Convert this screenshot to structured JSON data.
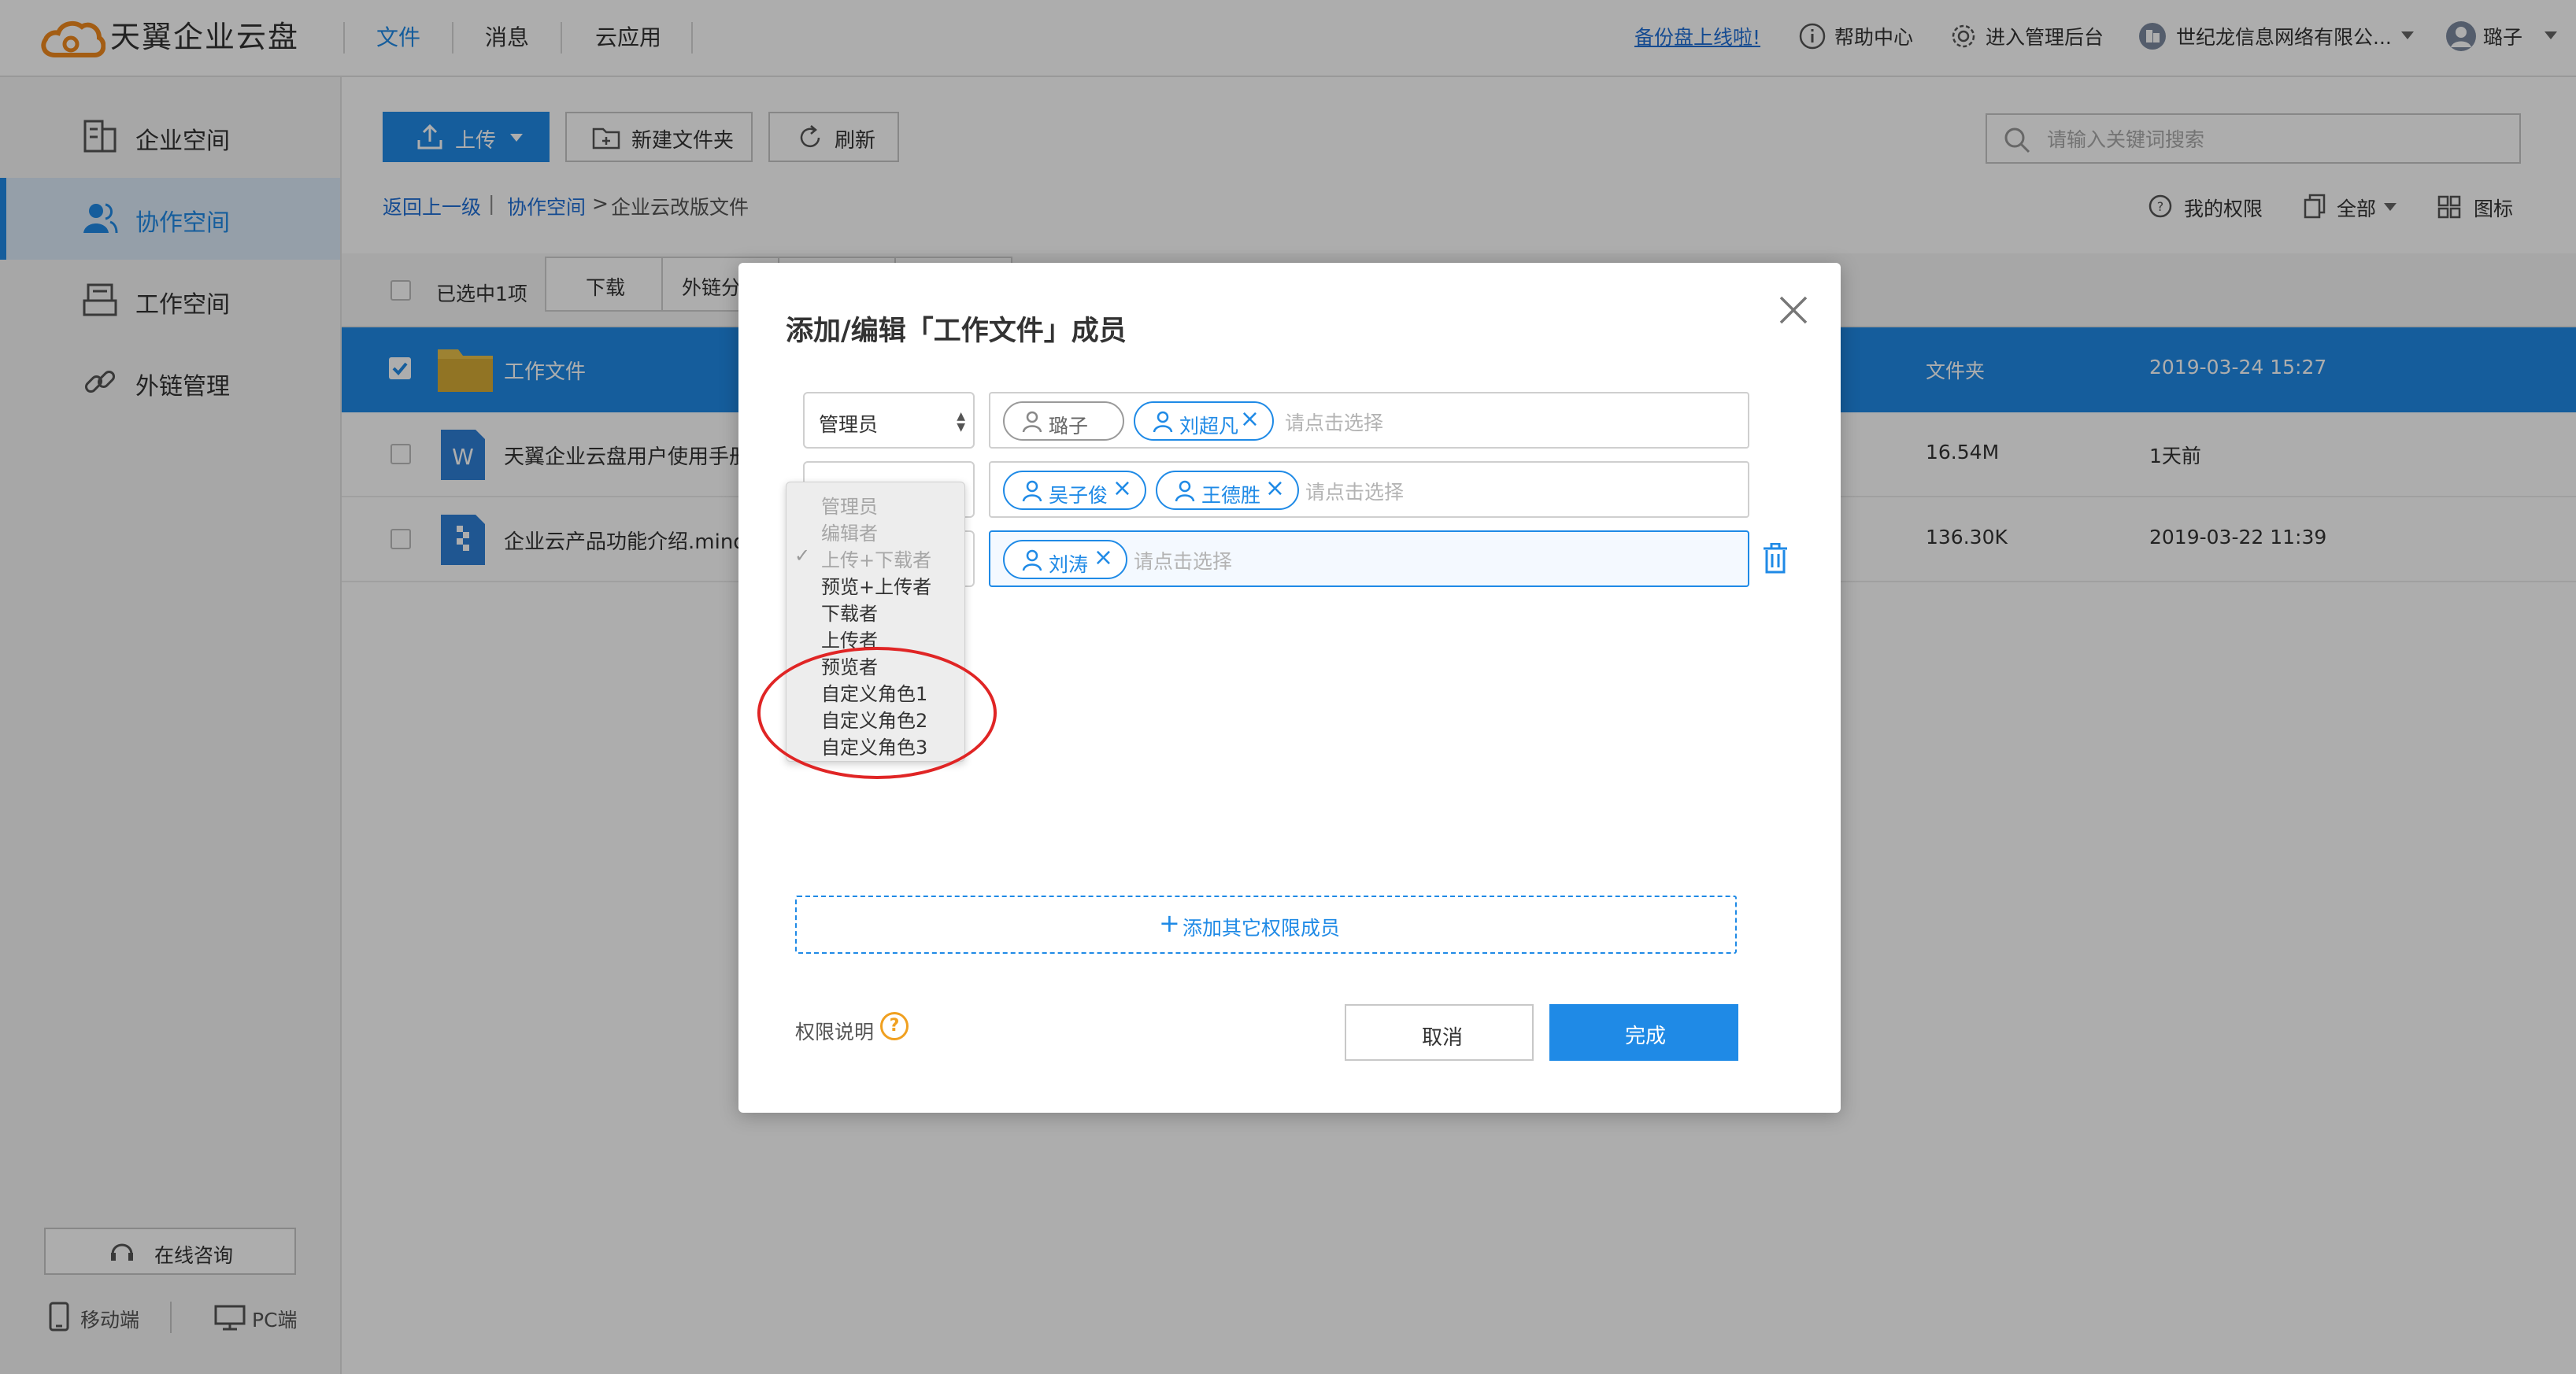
{
  "app": {
    "title": "天翼企业云盘"
  },
  "topnav": {
    "items": [
      {
        "label": "文件",
        "active": true
      },
      {
        "label": "消息",
        "active": false
      },
      {
        "label": "云应用",
        "active": false
      }
    ],
    "promo_link": "备份盘上线啦!",
    "help": "帮助中心",
    "admin": "进入管理后台",
    "company": "世纪龙信息网络有限公...",
    "user": "璐子"
  },
  "sidebar": {
    "items": [
      {
        "label": "企业空间",
        "icon": "building-icon"
      },
      {
        "label": "协作空间",
        "icon": "users-icon",
        "active": true
      },
      {
        "label": "工作空间",
        "icon": "tray-icon"
      },
      {
        "label": "外链管理",
        "icon": "link-icon"
      }
    ],
    "consult": "在线咨询",
    "mobile": "移动端",
    "pc": "PC端"
  },
  "toolbar": {
    "upload": "上传",
    "new_folder": "新建文件夹",
    "refresh": "刷新",
    "search_placeholder": "请输入关键词搜索"
  },
  "breadcrumb": {
    "back": "返回上一级",
    "sep": "|",
    "level1": "协作空间",
    "arrow": ">",
    "current": "企业云改版文件"
  },
  "view": {
    "my_perm": "我的权限",
    "all": "全部",
    "icon_view": "图标"
  },
  "selection": {
    "count": "已选中1项",
    "download": "下载",
    "share": "外链分"
  },
  "files": [
    {
      "name": "工作文件",
      "size": "文件夹",
      "time": "2019-03-24 15:27",
      "type": "folder",
      "selected": true
    },
    {
      "name": "天翼企业云盘用户使用手册-",
      "size": "16.54M",
      "time": "1天前",
      "type": "word",
      "selected": false
    },
    {
      "name": "企业云产品功能介绍.mindno",
      "size": "136.30K",
      "time": "2019-03-22 11:39",
      "type": "mind",
      "selected": false
    }
  ],
  "modal": {
    "title": "添加/编辑「工作文件」成员",
    "rows": [
      {
        "role": "管理员",
        "members": [
          "璐子",
          "刘超凡"
        ],
        "placeholder": "请点击选择"
      },
      {
        "role": "编辑者",
        "members": [
          "吴子俊",
          "王德胜"
        ],
        "placeholder": "请点击选择"
      },
      {
        "role": "上传+下载者",
        "members": [
          "刘涛"
        ],
        "placeholder": "请点击选择"
      }
    ],
    "add_member": "添加其它权限成员",
    "perm_desc": "权限说明",
    "qmark": "?",
    "cancel": "取消",
    "done": "完成"
  },
  "dropdown": {
    "options": [
      {
        "label": "管理员",
        "disabled": true
      },
      {
        "label": "编辑者",
        "disabled": true
      },
      {
        "label": "上传+下载者",
        "disabled": true,
        "checked": true
      },
      {
        "label": "预览+上传者"
      },
      {
        "label": "下载者"
      },
      {
        "label": "上传者"
      },
      {
        "label": "预览者"
      },
      {
        "label": "自定义角色1"
      },
      {
        "label": "自定义角色2"
      },
      {
        "label": "自定义角色3"
      }
    ],
    "check_mark": "✓"
  },
  "colors": {
    "accent": "#1f8ae6",
    "highlight_circle": "#e02525",
    "folder": "#e8c04a"
  }
}
